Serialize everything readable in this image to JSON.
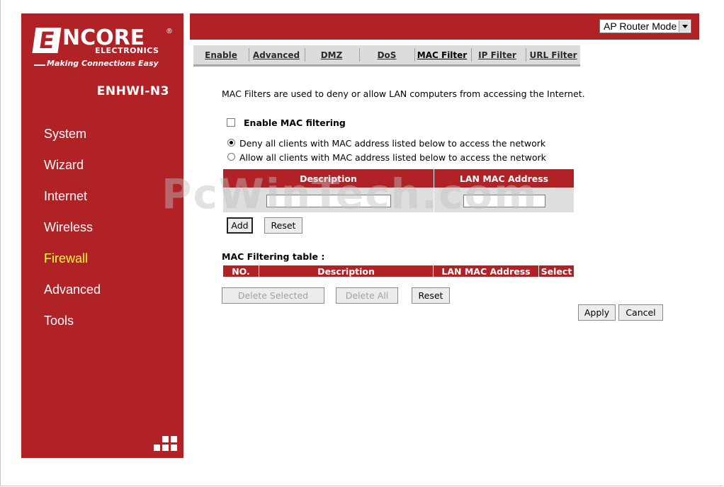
{
  "brand": {
    "logo_letter": "E",
    "logo_main": "NCORE",
    "logo_reg": "®",
    "logo_sub": "ELECTRONICS",
    "tagline": "Making Connections Easy",
    "model": "ENHWI-N3"
  },
  "sidebar": {
    "items": [
      {
        "label": "System"
      },
      {
        "label": "Wizard"
      },
      {
        "label": "Internet"
      },
      {
        "label": "Wireless"
      },
      {
        "label": "Firewall",
        "active": true
      },
      {
        "label": "Advanced"
      },
      {
        "label": "Tools"
      }
    ]
  },
  "topbar": {
    "mode_selected": "AP Router Mode"
  },
  "tabs": [
    {
      "label": "Enable"
    },
    {
      "label": "Advanced"
    },
    {
      "label": "DMZ"
    },
    {
      "label": "DoS"
    },
    {
      "label": "MAC Filter",
      "active": true
    },
    {
      "label": "IP Filter"
    },
    {
      "label": "URL Filter"
    }
  ],
  "content": {
    "intro": "MAC Filters are used to deny or allow LAN computers from accessing the Internet.",
    "enable_label": "Enable MAC filtering",
    "enable_checked": false,
    "radio_deny": "Deny all clients with MAC address listed below to access the network",
    "radio_allow": "Allow all clients with MAC address listed below to access the network",
    "radio_selected": "deny",
    "entry_headers": {
      "description": "Description",
      "mac": "LAN MAC Address"
    },
    "description_value": "",
    "mac_value": "",
    "add_label": "Add",
    "reset_label": "Reset",
    "table_title": "MAC Filtering table :",
    "list_headers": {
      "no": "NO.",
      "description": "Description",
      "mac": "LAN MAC Address",
      "select": "Select"
    },
    "delete_selected_label": "Delete Selected",
    "delete_all_label": "Delete All",
    "reset2_label": "Reset",
    "apply_label": "Apply",
    "cancel_label": "Cancel"
  },
  "watermark": "PcWinTech.com",
  "colors": {
    "brand_red": "#b12227",
    "active_nav": "#ffff33"
  }
}
